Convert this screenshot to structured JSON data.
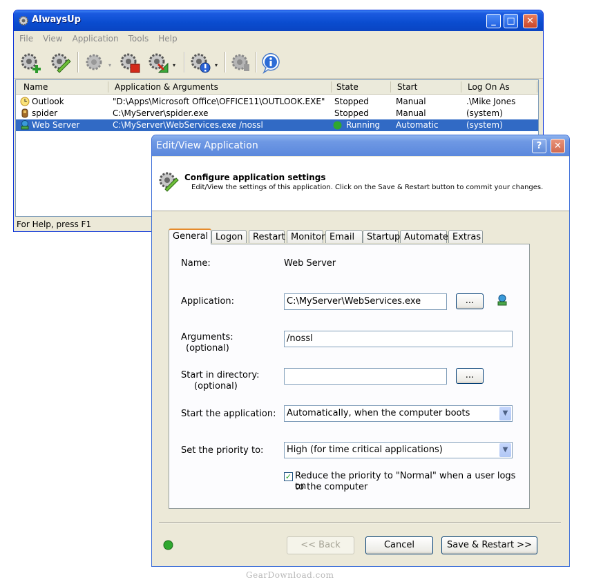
{
  "main_window": {
    "title": "AlwaysUp",
    "title_buttons": {
      "minimize": "_",
      "maximize": "□",
      "close": "✕"
    },
    "menu": [
      "File",
      "View",
      "Application",
      "Tools",
      "Help"
    ],
    "toolbar": [
      "add-application",
      "edit-application",
      "start-application",
      "stop-application",
      "restart-application",
      "report-activity",
      "tools",
      "about"
    ],
    "columns": [
      "Name",
      "Application & Arguments",
      "State",
      "Start",
      "Log On As"
    ],
    "rows": [
      {
        "name": "Outlook",
        "app": "\"D:\\Apps\\Microsoft Office\\OFFICE11\\OUTLOOK.EXE\"",
        "state": "Stopped",
        "start": "Manual",
        "logon": ".\\Mike Jones",
        "icon": "clock-icon"
      },
      {
        "name": "spider",
        "app": "C:\\MyServer\\spider.exe",
        "state": "Stopped",
        "start": "Manual",
        "logon": "(system)",
        "icon": "spider-icon"
      },
      {
        "name": "Web Server",
        "app": "C:\\MyServer\\WebServices.exe /nossl",
        "state": "Running",
        "start": "Automatic",
        "logon": "(system)",
        "icon": "globe-icon"
      }
    ],
    "status": "For Help, press F1"
  },
  "dialog": {
    "title": "Edit/View Application",
    "title_buttons": {
      "help": "?",
      "close": "✕"
    },
    "header_title": "Configure application settings",
    "header_subtitle": "Edit/View the settings of this application. Click on the Save & Restart button to commit your changes.",
    "tabs": [
      "General",
      "Logon",
      "Restart",
      "Monitor",
      "Email",
      "Startup",
      "Automate",
      "Extras"
    ],
    "active_tab": "General",
    "form": {
      "name_label": "Name:",
      "name_value": "Web Server",
      "application_label": "Application:",
      "application_value": "C:\\MyServer\\WebServices.exe",
      "browse_label": "...",
      "arguments_label": "Arguments:",
      "arguments_optional": "(optional)",
      "arguments_value": "/nossl",
      "directory_label": "Start in directory:",
      "directory_optional": "(optional)",
      "directory_value": "",
      "start_label": "Start the application:",
      "start_value": "Automatically, when the computer boots",
      "priority_label": "Set the priority to:",
      "priority_value": "High (for time critical applications)",
      "reduce_checked": true,
      "reduce_label_1": "Reduce the priority to \"Normal\" when a user logs on",
      "reduce_label_2": "to the computer"
    },
    "buttons": {
      "back": "<< Back",
      "cancel": "Cancel",
      "save": "Save & Restart >>"
    }
  },
  "watermark": "GearDownload.com",
  "colors": {
    "selection": "#316ac5",
    "running": "#2fa82f",
    "title_active": "#0a4ccf"
  }
}
